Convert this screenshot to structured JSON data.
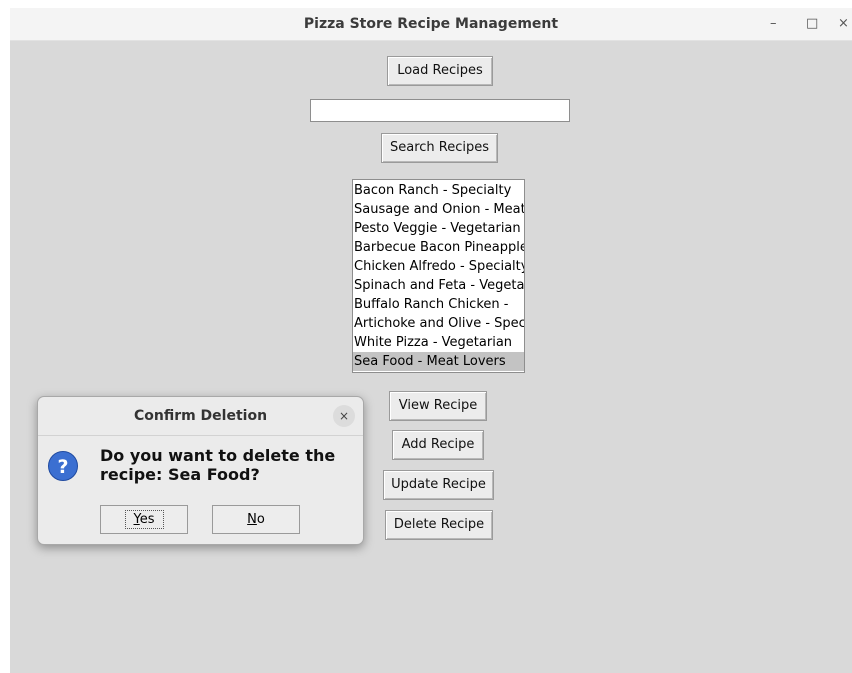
{
  "window": {
    "title": "Pizza Store Recipe Management",
    "minimize": "–",
    "maximize": "□",
    "close": "×"
  },
  "toolbar": {
    "load_label": "Load Recipes",
    "search_value": "",
    "search_label": "Search Recipes",
    "view_label": "View Recipe",
    "add_label": "Add Recipe",
    "update_label": "Update Recipe",
    "delete_label": "Delete Recipe"
  },
  "recipes": {
    "items": [
      "Bacon Ranch - Specialty",
      "Sausage and Onion - Meat Lovers",
      "Pesto Veggie - Vegetarian",
      "Barbecue Bacon Pineapple",
      "Chicken Alfredo - Specialty",
      "Spinach and Feta - Vegetarian",
      "Buffalo Ranch Chicken -",
      "Artichoke and Olive - Specialty",
      "White Pizza - Vegetarian",
      "Sea Food - Meat Lovers"
    ],
    "selected_index": 9
  },
  "dialog": {
    "title": "Confirm Deletion",
    "close": "×",
    "icon": "question-icon",
    "message": "Do you want to delete the recipe: Sea Food?",
    "yes_underlined": "Y",
    "yes_rest": "es",
    "no_underlined": "N",
    "no_rest": "o"
  },
  "colors": {
    "window_bg": "#d9d9d9",
    "titlebar_bg": "#f4f4f4",
    "selection": "#c3c3c3",
    "icon_blue": "#3b6fd1"
  }
}
